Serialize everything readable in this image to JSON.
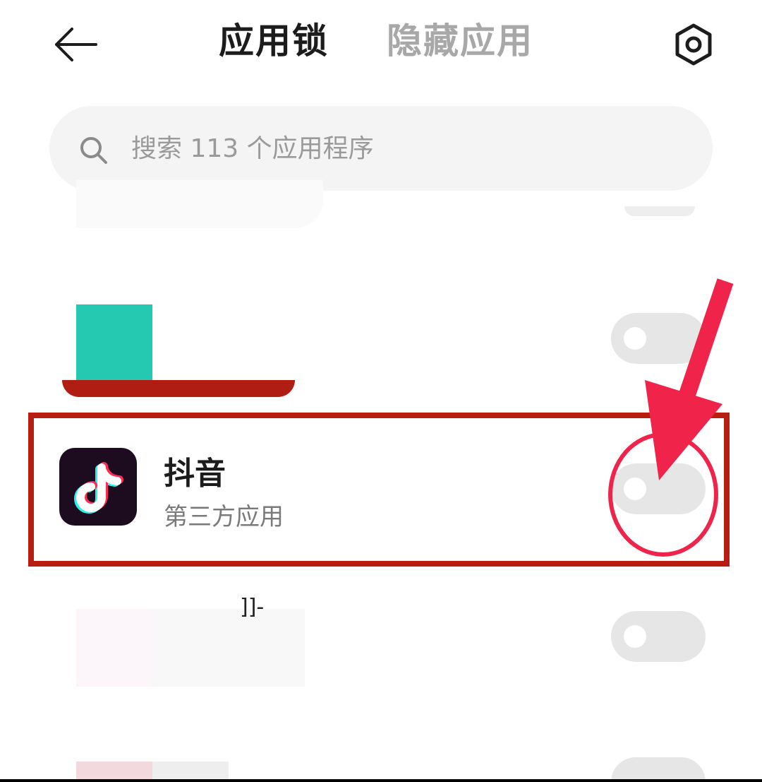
{
  "header": {
    "back_icon": "arrow-left-icon",
    "tabs": [
      {
        "label": "应用锁",
        "active": true
      },
      {
        "label": "隐藏应用",
        "active": false
      }
    ],
    "settings_icon": "hexagon-gear-icon"
  },
  "search": {
    "placeholder": "搜索 113 个应用程序",
    "icon": "search-icon"
  },
  "apps": [
    {
      "name": "抖音",
      "subtitle": "第三方应用",
      "icon": "douyin-icon",
      "locked": false
    }
  ],
  "fragments": {
    "partial_text": "]]-"
  },
  "annotations": {
    "highlight_color": "#b91d12",
    "arrow_color": "#f0234a",
    "circle_color": "#f0234a"
  },
  "colors": {
    "toggle_off": "#e6e6e6",
    "text_primary": "#1c1c1c",
    "text_secondary": "#7a7a7a",
    "tab_inactive": "#a8a8a8"
  }
}
